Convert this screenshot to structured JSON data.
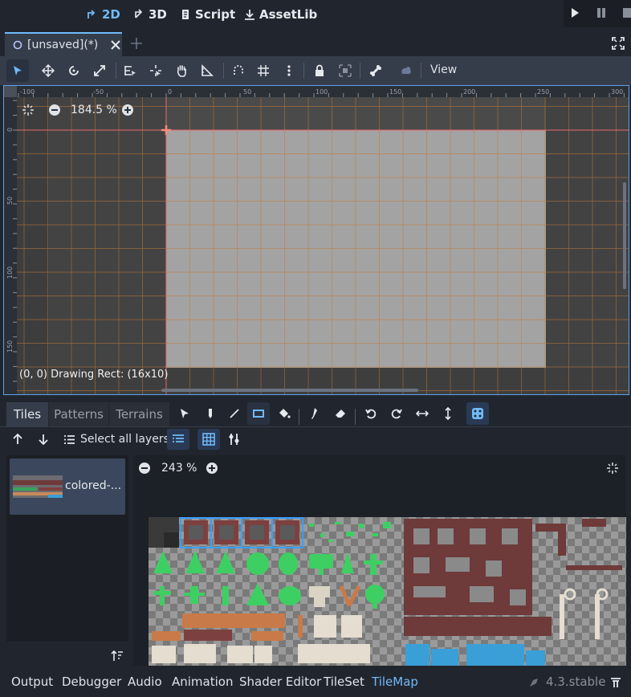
{
  "top_bar": {
    "modes": [
      {
        "label": "2D",
        "icon": "2d-icon",
        "active": true
      },
      {
        "label": "3D",
        "icon": "3d-icon",
        "active": false
      },
      {
        "label": "Script",
        "icon": "script-icon",
        "active": false
      },
      {
        "label": "AssetLib",
        "icon": "assetlib-icon",
        "active": false
      }
    ],
    "playback": [
      "play-icon",
      "pause-icon",
      "stop-icon"
    ]
  },
  "scene_tabs": {
    "tabs": [
      {
        "label": "[unsaved](*)",
        "icon": "scene-icon"
      }
    ],
    "add_tab": "plus-icon",
    "distraction_free": "expand-icon"
  },
  "toolbar": {
    "tools": [
      "select-icon",
      "move-icon",
      "rotate-icon",
      "scale-icon",
      "list-select-icon",
      "pivot-icon",
      "pan-icon",
      "ruler-icon",
      "smart-snap-icon",
      "grid-snap-icon",
      "more-icon",
      "lock-icon",
      "group-icon",
      "bone-icon",
      "light-icon"
    ],
    "view_label": "View"
  },
  "viewport": {
    "zoom_label": "184.5 %",
    "status_text": "(0, 0) Drawing Rect: (16x10)",
    "ruler_h_labels": [
      "-100",
      "-50",
      "0",
      "50",
      "100",
      "150",
      "200",
      "250",
      "300"
    ],
    "ruler_v_labels": [
      "0",
      "50",
      "100",
      "150"
    ],
    "accent_color": "#5ea1e8",
    "grid_color": "#c27a3a"
  },
  "tilemap_panel": {
    "tabs": [
      "Tiles",
      "Patterns",
      "Terrains"
    ],
    "active_tab": "Tiles",
    "select_all_layers": "Select all layers",
    "source_name": "colored-...",
    "atlas_zoom": "243 %",
    "paint_tools": [
      "select-icon",
      "pencil-icon",
      "line-icon",
      "rect-icon",
      "bucket-icon",
      "picker-icon",
      "eraser-icon",
      "rotate-left-icon",
      "rotate-right-icon",
      "flip-h-icon",
      "flip-v-icon",
      "random-icon"
    ]
  },
  "bottom_bar": {
    "tabs": [
      "Output",
      "Debugger",
      "Audio",
      "Animation",
      "Shader Editor",
      "TileSet",
      "TileMap"
    ],
    "active_tab": "TileMap",
    "version": "4.3.stable"
  }
}
